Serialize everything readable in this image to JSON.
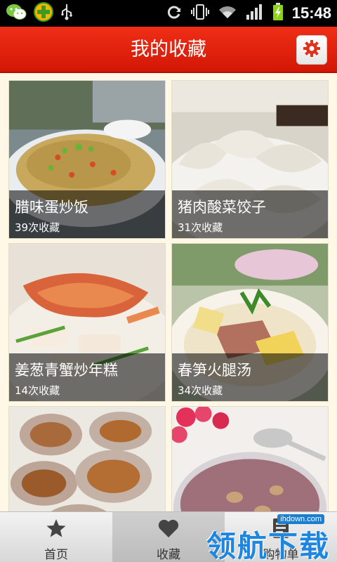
{
  "status_bar": {
    "time": "15:48",
    "left_icons": [
      "wechat-icon",
      "plus-app-icon",
      "usb-icon"
    ],
    "right_icons": [
      "sync-icon",
      "vibrate-icon",
      "wifi-icon",
      "signal-icon",
      "battery-charging-icon"
    ]
  },
  "header": {
    "title": "我的收藏",
    "settings_icon": "gear-icon",
    "accent": "#e12a12"
  },
  "recipes": [
    {
      "name": "腊味蛋炒饭",
      "favorites": "39次收藏",
      "image": "fried-rice-photo"
    },
    {
      "name": "猪肉酸菜饺子",
      "favorites": "31次收藏",
      "image": "dumplings-photo"
    },
    {
      "name": "姜葱青蟹炒年糕",
      "favorites": "14次收藏",
      "image": "crab-rice-cake-photo"
    },
    {
      "name": "春笋火腿汤",
      "favorites": "34次收藏",
      "image": "bamboo-ham-soup-photo"
    },
    {
      "name": "",
      "favorites": "",
      "image": "abalone-photo"
    },
    {
      "name": "",
      "favorites": "",
      "image": "porridge-photo"
    }
  ],
  "tabs": [
    {
      "label": "首页",
      "icon": "star-icon",
      "active": false
    },
    {
      "label": "收藏",
      "icon": "heart-icon",
      "active": true
    },
    {
      "label": "购物单",
      "icon": "list-icon",
      "active": false
    }
  ],
  "watermark": {
    "text": "领航下载",
    "site": "ihdown.com"
  }
}
